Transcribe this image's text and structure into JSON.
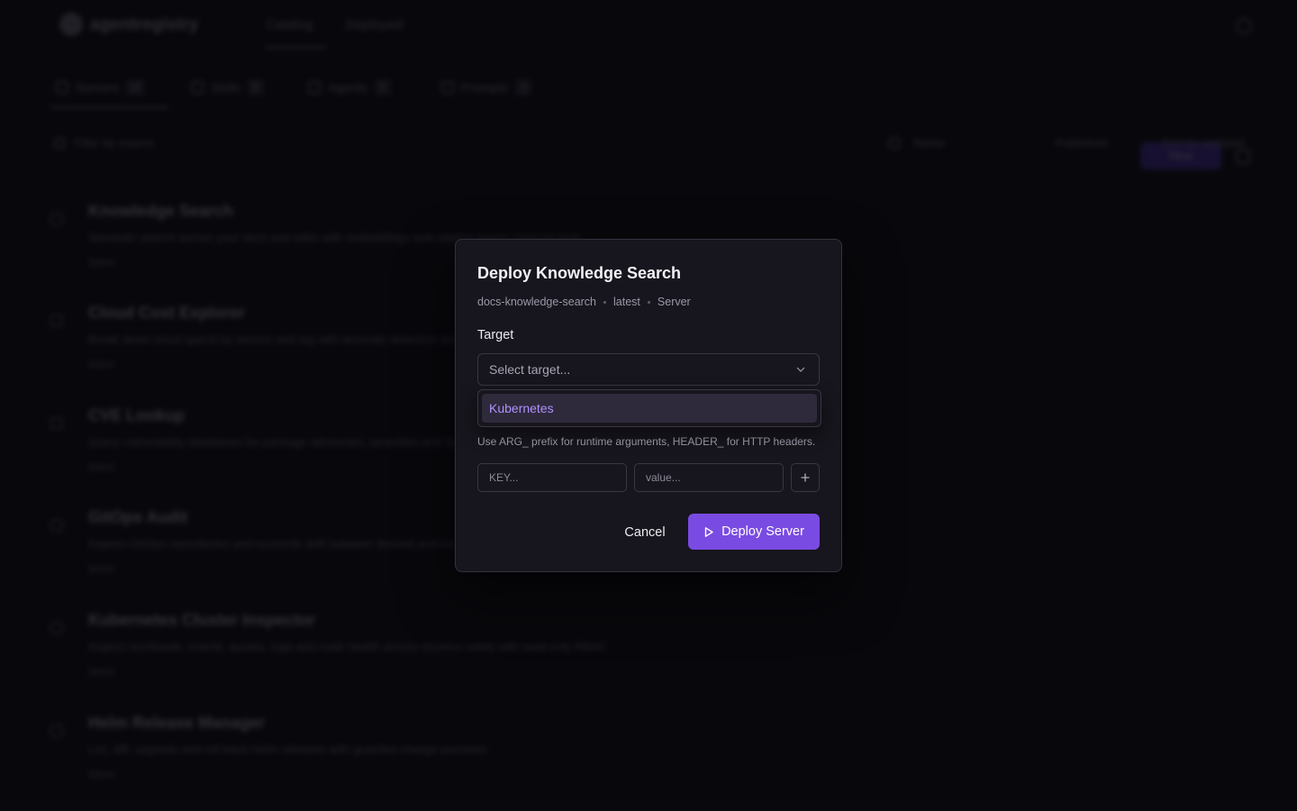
{
  "background": {
    "brand": "agentregistry",
    "nav": [
      "Catalog",
      "Deployed"
    ],
    "tabs": [
      {
        "label": "Servers",
        "count": "12"
      },
      {
        "label": "Skills",
        "count": "8"
      },
      {
        "label": "Agents",
        "count": "5"
      },
      {
        "label": "Prompts",
        "count": "3"
      }
    ],
    "new_button": "New",
    "filter_label": "Filter by source",
    "sort_label": "Name",
    "view_a": "Published",
    "view_b": "Sort by updated",
    "servers": [
      {
        "title": "Knowledge Search",
        "desc": "Semantic search across your docs and wikis with embeddings and citation-aware retrieval tools",
        "tag": "latest"
      },
      {
        "title": "Cloud Cost Explorer",
        "desc": "Break down cloud spend by service and tag with anomaly detection and forecasts",
        "tag": "latest"
      },
      {
        "title": "CVE Lookup",
        "desc": "Query vulnerability databases for package advisories, severities and fixed versions",
        "tag": "latest"
      },
      {
        "title": "GitOps Audit",
        "desc": "Inspect GitOps repositories and reconcile drift between desired and live cluster state",
        "tag": "latest"
      },
      {
        "title": "Kubernetes Cluster Inspector",
        "desc": "Inspect workloads, events, quotas, logs and node health across clusters safely with read-only RBAC",
        "tag": "latest"
      },
      {
        "title": "Helm Release Manager",
        "desc": "List, diff, upgrade and roll back Helm releases with guarded change previews",
        "tag": "latest"
      }
    ]
  },
  "modal": {
    "title": "Deploy Knowledge Search",
    "meta": [
      "docs-knowledge-search",
      "latest",
      "Server"
    ],
    "target_label": "Target",
    "target_placeholder": "Select target...",
    "dropdown_options": [
      "Kubernetes"
    ],
    "hint": "Use ARG_ prefix for runtime arguments, HEADER_ for HTTP headers.",
    "env_key_placeholder": "KEY...",
    "env_value_placeholder": "value...",
    "cancel_label": "Cancel",
    "deploy_label": "Deploy Server"
  },
  "colors": {
    "accent": "#7a4be2",
    "option_highlight_text": "#b190ff",
    "modal_bg": "#17151d"
  },
  "icons": {
    "select": "chevron-down-icon",
    "add": "plus-icon",
    "deploy": "play-icon"
  }
}
